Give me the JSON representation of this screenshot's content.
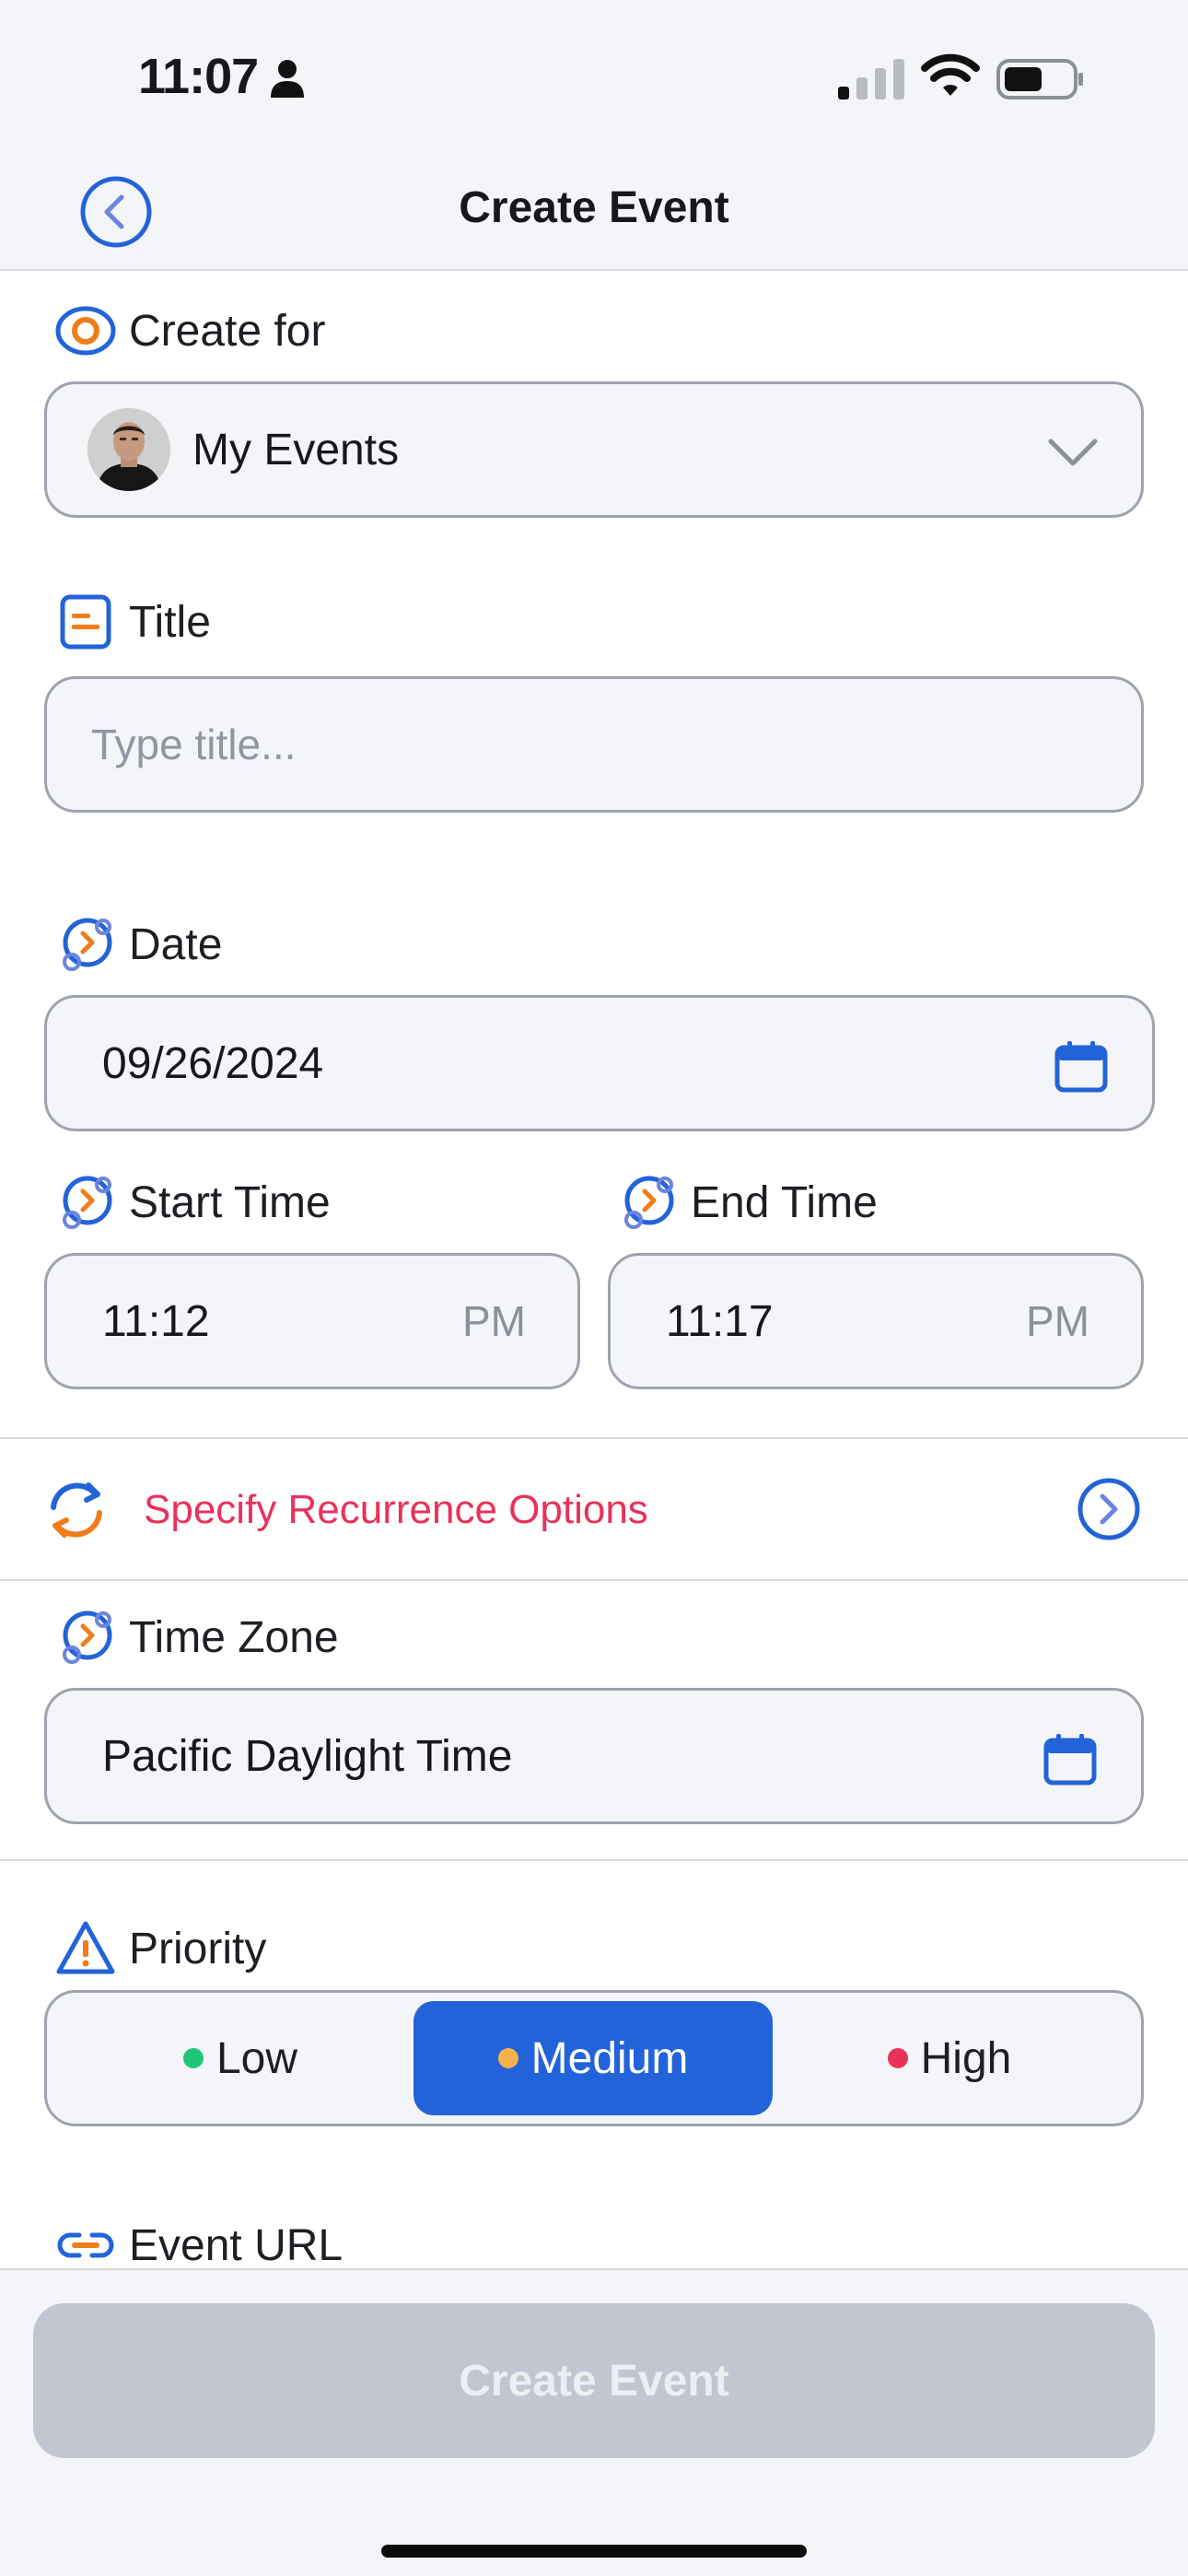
{
  "status_bar": {
    "time": "11:07"
  },
  "header": {
    "title": "Create Event"
  },
  "form": {
    "create_for": {
      "label": "Create for",
      "value": "My Events"
    },
    "title": {
      "label": "Title",
      "placeholder": "Type title..."
    },
    "date": {
      "label": "Date",
      "value": "09/26/2024"
    },
    "start_time": {
      "label": "Start Time",
      "value": "11:12",
      "period": "PM"
    },
    "end_time": {
      "label": "End Time",
      "value": "11:17",
      "period": "PM"
    },
    "recurrence": {
      "label": "Specify Recurrence Options"
    },
    "time_zone": {
      "label": "Time Zone",
      "value": "Pacific Daylight Time"
    },
    "priority": {
      "label": "Priority",
      "options": [
        {
          "label": "Low",
          "color": "#1fc67a"
        },
        {
          "label": "Medium",
          "color": "#f6b24a"
        },
        {
          "label": "High",
          "color": "#e8325c"
        }
      ],
      "selected": "Medium"
    },
    "event_url": {
      "label": "Event URL"
    }
  },
  "footer": {
    "button_label": "Create Event"
  },
  "colors": {
    "accent_blue": "#2263d9",
    "icon_orange": "#f07d1a",
    "recurrence_red": "#e8325c",
    "disabled_button": "#c1c6d1"
  }
}
